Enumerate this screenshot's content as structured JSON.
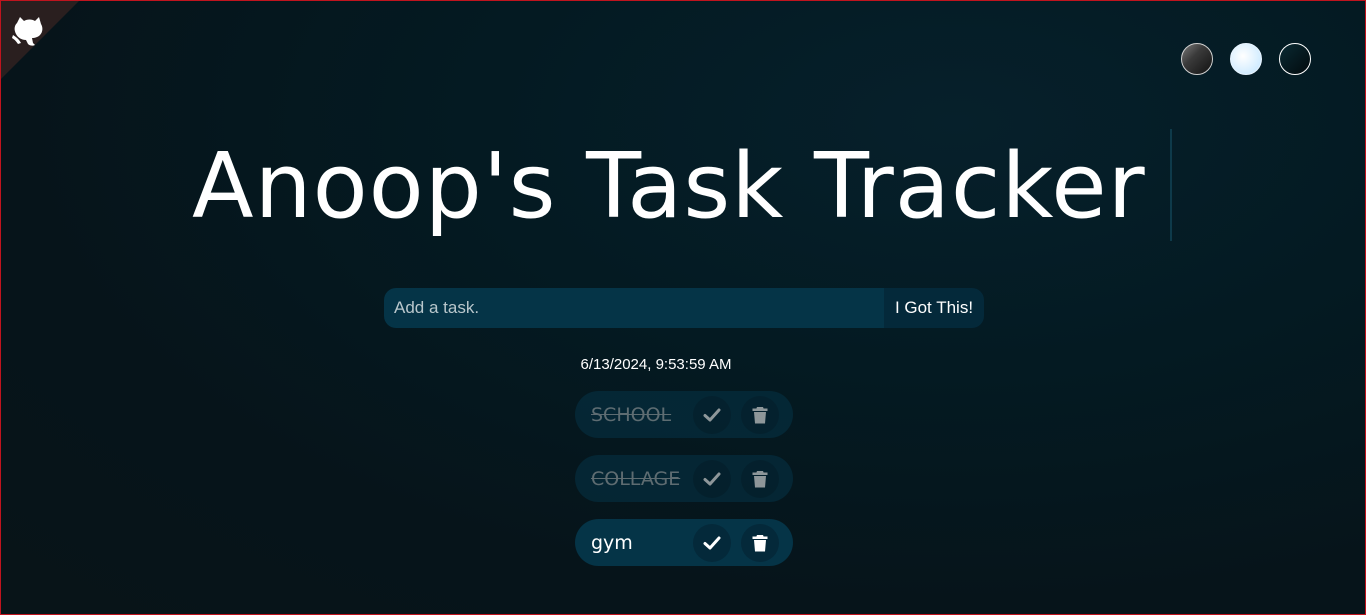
{
  "page": {
    "title": "Anoop's Task Tracker"
  },
  "theme_switcher": {
    "options": [
      "standard",
      "light",
      "darker"
    ]
  },
  "form": {
    "input_placeholder": "Add a task.",
    "input_value": "",
    "submit_label": "I Got This!"
  },
  "datetime": "6/13/2024, 9:53:59 AM",
  "tasks": [
    {
      "text": "SCHOOL",
      "completed": true
    },
    {
      "text": "COLLAGE",
      "completed": true
    },
    {
      "text": "gym",
      "completed": false
    }
  ],
  "icons": {
    "corner": "github-cat-icon",
    "check": "check-icon",
    "delete": "trash-icon"
  },
  "colors": {
    "background": "#06141a",
    "accent": "#053447",
    "button": "#04293a",
    "text": "#ffffff"
  }
}
